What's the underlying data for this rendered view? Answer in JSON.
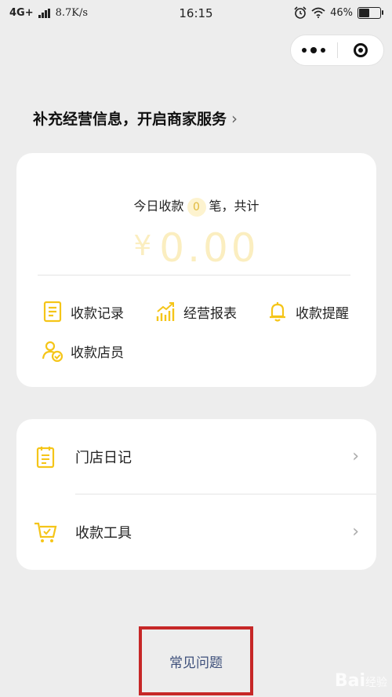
{
  "status_bar": {
    "network": "4G+",
    "speed": "8.7K/s",
    "time": "16:15",
    "battery": "46%",
    "battery_level": 0.46,
    "icons": [
      "signal-icon",
      "alarm-icon",
      "wifi-icon",
      "battery-icon"
    ]
  },
  "capsule": {
    "icons": [
      "more-icon",
      "close-miniprogram-icon"
    ]
  },
  "promo": {
    "text": "补充经营信息，开启商家服务",
    "chevron": "›"
  },
  "summary": {
    "prefix": "今日收款",
    "count": "0",
    "suffix": "笔，共计",
    "currency": "¥",
    "amount": "0.00"
  },
  "functions": [
    {
      "label": "收款记录",
      "icon": "receipt-record-icon"
    },
    {
      "label": "经营报表",
      "icon": "chart-report-icon"
    },
    {
      "label": "收款提醒",
      "icon": "bell-icon"
    },
    {
      "label": "收款店员",
      "icon": "staff-icon"
    }
  ],
  "menu": [
    {
      "label": "门店日记",
      "icon": "notebook-icon",
      "arrow": "›"
    },
    {
      "label": "收款工具",
      "icon": "cart-icon",
      "arrow": "›"
    }
  ],
  "faq": {
    "label": "常见问题"
  },
  "watermark": {
    "text": "Bai",
    "sub": "经验"
  },
  "colors": {
    "accent": "#f5c518",
    "faq_link": "#3d4f7a",
    "highlight_border": "#c62727"
  }
}
